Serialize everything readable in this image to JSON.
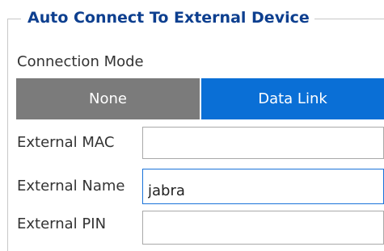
{
  "group": {
    "title": "Auto Connect To External Device"
  },
  "connection_mode": {
    "label": "Connection Mode",
    "options": [
      {
        "label": "None",
        "selected": false
      },
      {
        "label": "Data Link",
        "selected": true
      }
    ]
  },
  "fields": {
    "mac": {
      "label": "External MAC",
      "value": ""
    },
    "name": {
      "label": "External Name",
      "value": "jabra"
    },
    "pin": {
      "label": "External PIN",
      "value": ""
    }
  },
  "colors": {
    "title": "#0d3f8f",
    "selected_segment": "#0a6fd6",
    "unselected_segment": "#7b7b7b",
    "focused_border": "#1a73d9"
  }
}
